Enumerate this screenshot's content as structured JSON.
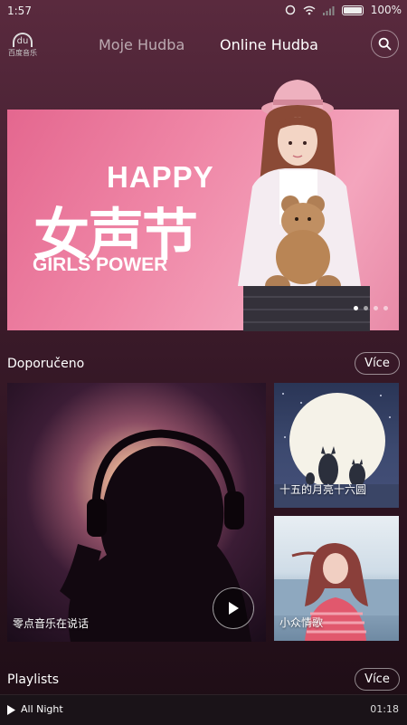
{
  "status_bar": {
    "time": "1:57",
    "battery": "100%"
  },
  "header": {
    "logo_text": "du",
    "logo_caption": "百度音乐",
    "tab_my_music": "Moje Hudba",
    "tab_online_music": "Online Hudba",
    "search_icon": "search-icon"
  },
  "banner": {
    "happy": "HAPPY",
    "chinese_title": "女声节",
    "girls_power": "GIRLS POWER",
    "page_count": 4,
    "active_page": 1
  },
  "recommended": {
    "title": "Doporučeno",
    "more_label": "Více",
    "cards": [
      {
        "label": "零点音乐在说话"
      },
      {
        "label": "十五的月亮十六圆"
      },
      {
        "label": "小众情歌"
      }
    ]
  },
  "playlists": {
    "title": "Playlists",
    "more_label": "Více"
  },
  "player": {
    "track": "All Night",
    "time": "01:18",
    "icon": "play-icon"
  },
  "colors": {
    "banner_pink": "#ef86a6",
    "background_dark": "#2c1320"
  }
}
